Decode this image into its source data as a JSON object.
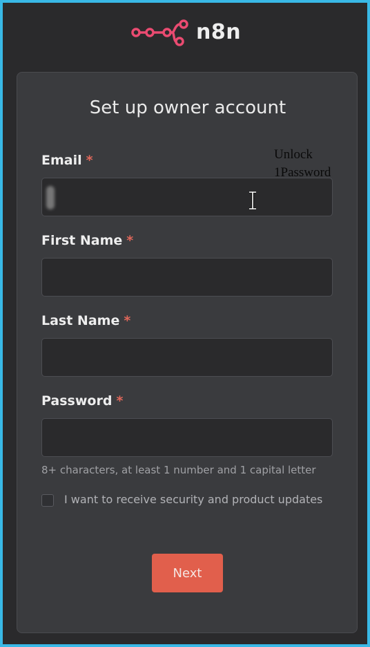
{
  "app": {
    "logo_text": "n8n"
  },
  "form": {
    "title": "Set up owner account",
    "required_mark": "*",
    "fields": {
      "email": {
        "label": "Email",
        "value": ""
      },
      "first_name": {
        "label": "First Name",
        "value": ""
      },
      "last_name": {
        "label": "Last Name",
        "value": ""
      },
      "password": {
        "label": "Password",
        "value": ""
      }
    },
    "password_hint": "8+ characters, at least 1 number and 1 capital letter",
    "updates_checkbox": {
      "label": "I want to receive security and product updates",
      "checked": false
    },
    "next_label": "Next"
  },
  "password_manager_popup": {
    "line1": "Unlock",
    "line2": "1Password"
  },
  "colors": {
    "brand": "#ea4b71",
    "accent_button": "#e15f4c",
    "required": "#e0675a",
    "frame_border": "#39b8e6"
  }
}
